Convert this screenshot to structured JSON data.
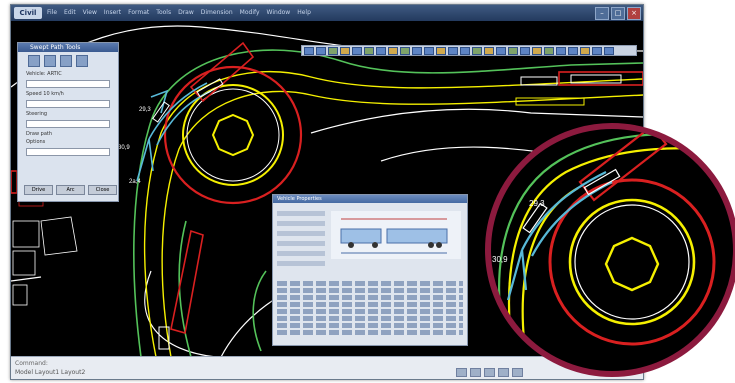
{
  "window": {
    "app_badge": "Civil",
    "menus": [
      "File",
      "Edit",
      "View",
      "Insert",
      "Format",
      "Tools",
      "Draw",
      "Dimension",
      "Modify",
      "Window",
      "Help"
    ]
  },
  "panel": {
    "title": "Swept Path Tools",
    "labels": [
      "Vehicle: ARTIC",
      "Speed 10 km/h",
      "Steering",
      "Draw path",
      "Options"
    ],
    "buttons": [
      "Drive",
      "Arc",
      "Close"
    ]
  },
  "dialog": {
    "title": "Vehicle Properties"
  },
  "dimensions": {
    "d1": "29,3",
    "d2": "30,9",
    "d3": "2a,4",
    "zoom_d1": "29,3",
    "zoom_d2": "30,9"
  },
  "statusbar": {
    "command": "Command:",
    "status": "Model  Layout1  Layout2"
  },
  "colors": {
    "background": "#000000",
    "road_green": "#54c25a",
    "road_yellow": "#f5f000",
    "circle_red": "#d92020",
    "vehicle_cyan": "#58b9d8",
    "zoom_ring": "#8c1a3e"
  }
}
